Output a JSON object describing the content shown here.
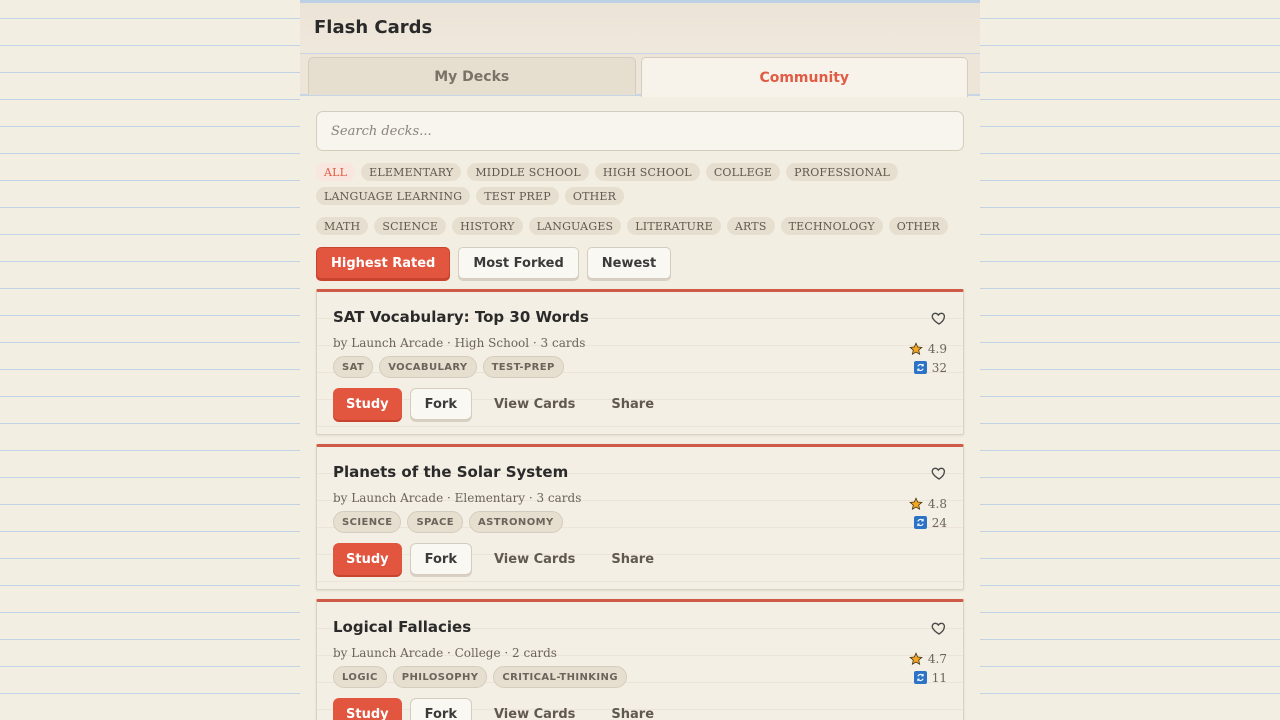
{
  "header": {
    "title": "Flash Cards"
  },
  "tabs": [
    {
      "label": "My Decks",
      "active": false
    },
    {
      "label": "Community",
      "active": true
    }
  ],
  "search": {
    "placeholder": "Search decks..."
  },
  "levels": [
    "ALL",
    "ELEMENTARY",
    "MIDDLE SCHOOL",
    "HIGH SCHOOL",
    "COLLEGE",
    "PROFESSIONAL",
    "LANGUAGE LEARNING",
    "TEST PREP",
    "OTHER"
  ],
  "subjects": [
    "MATH",
    "SCIENCE",
    "HISTORY",
    "LANGUAGES",
    "LITERATURE",
    "ARTS",
    "TECHNOLOGY",
    "OTHER"
  ],
  "sort": [
    {
      "label": "Highest Rated",
      "active": true
    },
    {
      "label": "Most Forked",
      "active": false
    },
    {
      "label": "Newest",
      "active": false
    }
  ],
  "actions": {
    "study": "Study",
    "fork": "Fork",
    "view": "View Cards",
    "share": "Share"
  },
  "decks": [
    {
      "title": "SAT Vocabulary: Top 30 Words",
      "meta": "by Launch Arcade · High School · 3 cards",
      "tags": [
        "SAT",
        "VOCABULARY",
        "TEST-PREP"
      ],
      "rating": "4.9",
      "forks": "32"
    },
    {
      "title": "Planets of the Solar System",
      "meta": "by Launch Arcade · Elementary · 3 cards",
      "tags": [
        "SCIENCE",
        "SPACE",
        "ASTRONOMY"
      ],
      "rating": "4.8",
      "forks": "24"
    },
    {
      "title": "Logical Fallacies",
      "meta": "by Launch Arcade · College · 2 cards",
      "tags": [
        "LOGIC",
        "PHILOSOPHY",
        "CRITICAL-THINKING"
      ],
      "rating": "4.7",
      "forks": "11"
    }
  ],
  "colors": {
    "accent": "#e2553f",
    "fork_icon": "#2c73c8",
    "star": "#f2a823"
  }
}
